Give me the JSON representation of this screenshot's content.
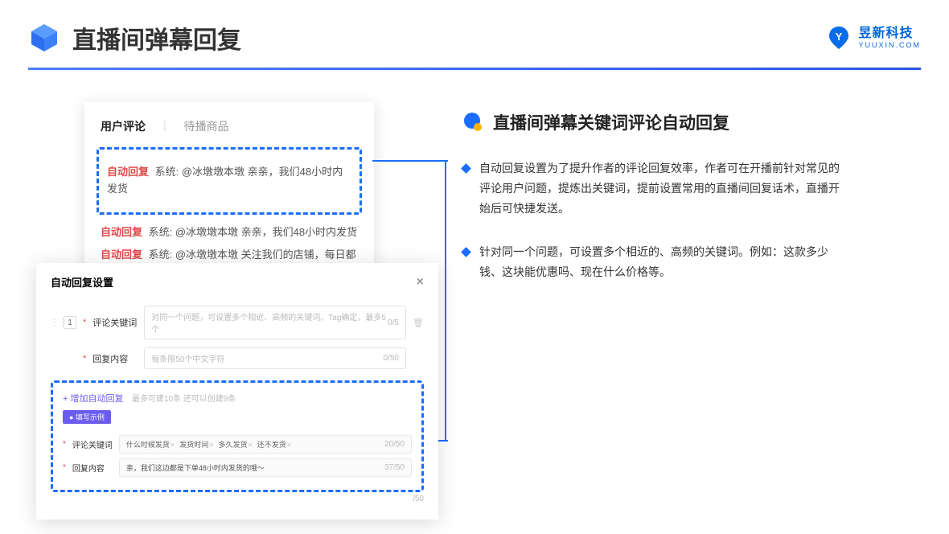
{
  "header": {
    "title": "直播间弹幕回复",
    "brand_name": "昱新科技",
    "brand_sub": "YUUXIN.COM"
  },
  "card_back": {
    "tab1": "用户评论",
    "tab2": "待播商品",
    "highlighted_prefix": "自动回复",
    "highlighted_text": "系统: @冰墩墩本墩 亲亲，我们48小时内发货",
    "line2_prefix": "自动回复",
    "line2_text": "系统: @冰墩墩本墩 亲亲，我们48小时内发货",
    "line3_prefix": "自动回复",
    "line3_text": "系统: @冰墩墩本墩 关注我们的店铺，每日都有热门推荐呦～"
  },
  "modal": {
    "title": "自动回复设置",
    "num": "1",
    "row1_label": "评论关键词",
    "row1_placeholder": "对同一个问题，可设置多个相近、高频的关键词。Tag确定，最多5个",
    "row1_counter": "0/5",
    "row2_label": "回复内容",
    "row2_placeholder": "每条限50个中文字符",
    "row2_counter": "0/50",
    "add_link": "+ 增加自动回复",
    "add_hint": "最多可建10条 还可以创建9条",
    "badge": "● 填写示例",
    "ex1_label": "评论关键词",
    "ex1_tag1": "什么时候发货",
    "ex1_tag2": "发货时间",
    "ex1_tag3": "多久发货",
    "ex1_tag4": "还不发货",
    "ex1_counter": "20/50",
    "ex2_label": "回复内容",
    "ex2_text": "亲，我们这边都是下单48小时内发货的哦～",
    "ex2_counter": "37/50",
    "tail_counter": "/50"
  },
  "right": {
    "section_title": "直播间弹幕关键词评论自动回复",
    "bullet1": "自动回复设置为了提升作者的评论回复效率，作者可在开播前针对常见的评论用户问题，提炼出关键词，提前设置常用的直播间回复话术，直播开始后可快捷发送。",
    "bullet2": "针对同一个问题，可设置多个相近的、高频的关键词。例如：这款多少钱、这块能优惠吗、现在什么价格等。"
  }
}
